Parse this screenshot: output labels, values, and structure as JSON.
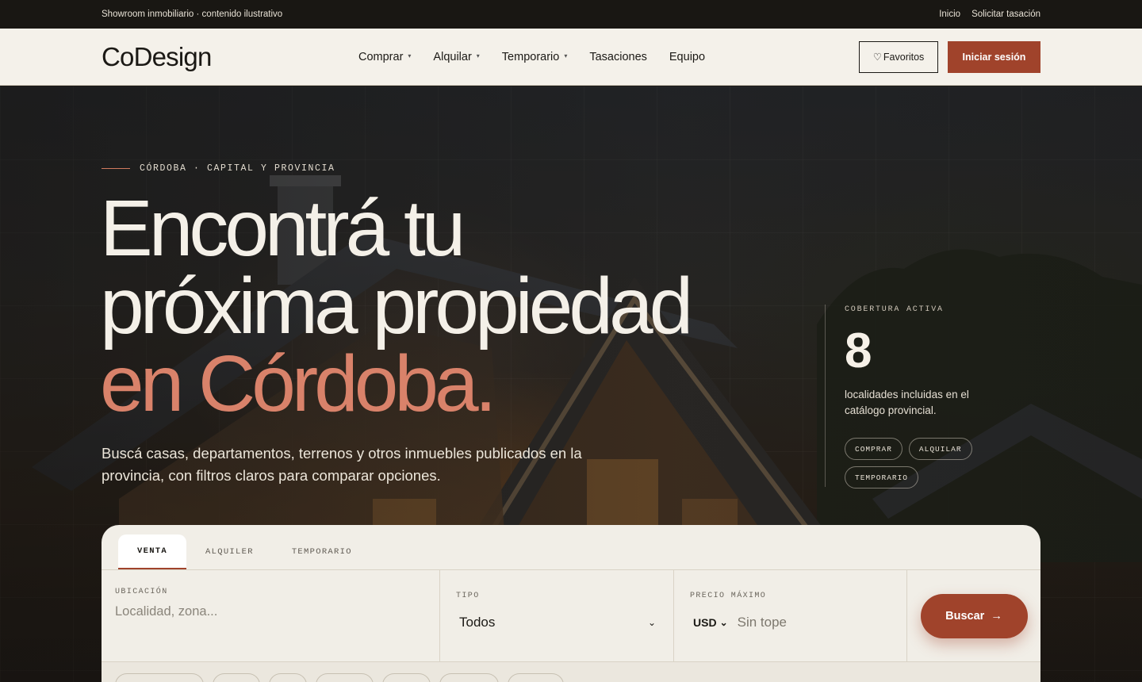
{
  "topbar": {
    "tagline": "Showroom inmobiliario · contenido ilustrativo",
    "links": [
      "Inicio",
      "Solicitar tasación"
    ]
  },
  "header": {
    "logo": "CoDesign",
    "nav": [
      {
        "label": "Comprar",
        "dropdown": true
      },
      {
        "label": "Alquilar",
        "dropdown": true
      },
      {
        "label": "Temporario",
        "dropdown": true
      },
      {
        "label": "Tasaciones",
        "dropdown": false
      },
      {
        "label": "Equipo",
        "dropdown": false
      }
    ],
    "favorites_label": "Favoritos",
    "login_label": "Iniciar sesión"
  },
  "hero": {
    "eyebrow": "CÓRDOBA · CAPITAL Y PROVINCIA",
    "headline_line1": "Encontrá tu",
    "headline_line2": "próxima propiedad",
    "headline_accent": "en Córdoba.",
    "subtitle": "Buscá casas, departamentos, terrenos y otros inmuebles publicados en la provincia, con filtros claros para comparar opciones.",
    "coverage": {
      "label": "COBERTURA ACTIVA",
      "number": "8",
      "description": "localidades incluidas en el catálogo provincial.",
      "chips": [
        "COMPRAR",
        "ALQUILAR",
        "TEMPORARIO"
      ]
    }
  },
  "search": {
    "tabs": [
      {
        "label": "VENTA",
        "active": true
      },
      {
        "label": "ALQUILER",
        "active": false
      },
      {
        "label": "TEMPORARIO",
        "active": false
      }
    ],
    "location": {
      "label": "UBICACIÓN",
      "placeholder": "Localidad, zona..."
    },
    "type": {
      "label": "TIPO",
      "selected": "Todos"
    },
    "price": {
      "label": "PRECIO MÁXIMO",
      "currency": "USD",
      "placeholder": "Sin tope"
    },
    "submit_label": "Buscar"
  },
  "colors": {
    "accent": "#a0432b",
    "accent_light": "#d9826a",
    "header_bg": "#f4f1ea",
    "dark": "#191713"
  },
  "icons": {
    "favorites": "heart-icon",
    "submit": "arrow-right-icon",
    "dropdown": "chevron-down-icon"
  }
}
